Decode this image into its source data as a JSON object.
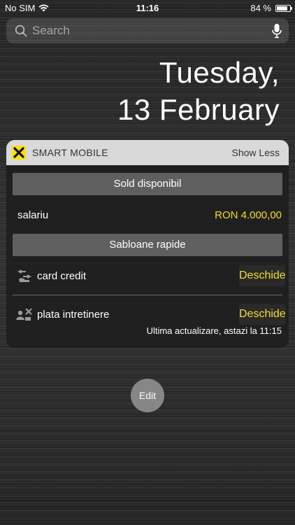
{
  "status_bar": {
    "carrier": "No SIM",
    "time": "11:16",
    "battery": "84 %",
    "battery_level": 0.84
  },
  "search": {
    "placeholder": "Search"
  },
  "date": {
    "line1": "Tuesday,",
    "line2": "13 February"
  },
  "widget": {
    "title": "SMART MOBILE",
    "show_less": "Show Less",
    "balance_header": "Sold disponibil",
    "account_name": "salariu",
    "account_amount": "RON 4.000,00",
    "templates_header": "Sabloane rapide",
    "templates": [
      {
        "name": "card credit",
        "action": "Deschide"
      },
      {
        "name": "plata intretinere",
        "action": "Deschide"
      }
    ],
    "last_update": "Ultima actualizare, astazi la 11:15",
    "accent_color": "#f4dc2a"
  },
  "edit": {
    "label": "Edit"
  }
}
